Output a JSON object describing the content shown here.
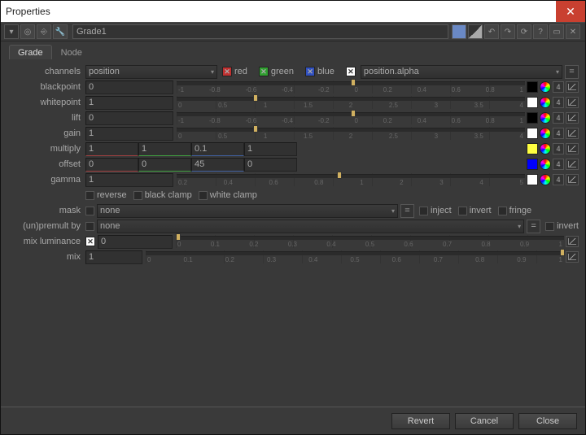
{
  "title": "Properties",
  "node_name": "Grade1",
  "tabs": {
    "grade": "Grade",
    "node": "Node"
  },
  "labels": {
    "channels": "channels",
    "blackpoint": "blackpoint",
    "whitepoint": "whitepoint",
    "lift": "lift",
    "gain": "gain",
    "multiply": "multiply",
    "offset": "offset",
    "gamma": "gamma",
    "reverse": "reverse",
    "black_clamp": "black clamp",
    "white_clamp": "white clamp",
    "mask": "mask",
    "unpremult": "(un)premult by",
    "mix_luminance": "mix luminance",
    "mix": "mix",
    "inject": "inject",
    "invert": "invert",
    "fringe": "fringe"
  },
  "channels": {
    "main": "position",
    "red": "red",
    "green": "green",
    "blue": "blue",
    "alpha_dd": "position.alpha"
  },
  "values": {
    "blackpoint": "0",
    "whitepoint": "1",
    "lift": "0",
    "gain": "1",
    "multiply": [
      "1",
      "1",
      "0.1",
      "1"
    ],
    "offset": [
      "0",
      "0",
      "45",
      "0"
    ],
    "gamma": "1",
    "mask": "none",
    "unpremult": "none",
    "mix_luminance": "0",
    "mix": "1"
  },
  "ticks_neg1_1": [
    "-1",
    "-0.8",
    "-0.6",
    "-0.4",
    "-0.2",
    "0",
    "0.2",
    "0.4",
    "0.6",
    "0.8",
    "1"
  ],
  "ticks_0_4": [
    "0",
    "0.5",
    "1",
    "1.5",
    "2",
    "2.5",
    "3",
    "3.5",
    "4"
  ],
  "ticks_0_1": [
    "0",
    "0.1",
    "0.2",
    "0.3",
    "0.4",
    "0.5",
    "0.6",
    "0.7",
    "0.8",
    "0.9",
    "1"
  ],
  "ticks_02_5": [
    "0.2",
    "0.4",
    "0.6",
    "0.8",
    "1",
    "2",
    "3",
    "4",
    "5"
  ],
  "four": "4",
  "eq": "=",
  "x": "✕",
  "footer": {
    "revert": "Revert",
    "cancel": "Cancel",
    "close": "Close"
  }
}
